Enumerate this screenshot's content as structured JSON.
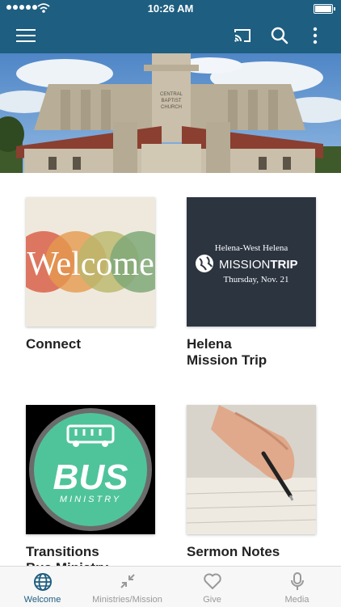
{
  "status_bar": {
    "time": "10:26 AM"
  },
  "colors": {
    "brand": "#1e5e80",
    "tab_inactive": "#999999",
    "bus_green": "#4fc49a"
  },
  "toolbar": {
    "icons": [
      "menu-icon",
      "cast-icon",
      "search-icon",
      "more-vertical-icon"
    ]
  },
  "hero": {
    "sign_text": "CENTRAL\nBAPTIST\nCHURCH"
  },
  "cards": [
    {
      "title": "Connect",
      "thumb_text": "Welcome"
    },
    {
      "title": "Helena\nMission Trip",
      "thumb_line1": "Helena-West Helena",
      "thumb_line2a": "MISSION",
      "thumb_line2b": "TRIP",
      "thumb_line3": "Thursday, Nov. 21"
    },
    {
      "title": "Transitions\nBus Ministry",
      "thumb_big": "BUS",
      "thumb_small": "MINISTRY"
    },
    {
      "title": "Sermon Notes"
    }
  ],
  "tabs": [
    {
      "label": "Welcome",
      "icon": "globe-icon",
      "active": true
    },
    {
      "label": "Ministries/Mission",
      "icon": "compress-icon",
      "active": false
    },
    {
      "label": "Give",
      "icon": "heart-icon",
      "active": false
    },
    {
      "label": "Media",
      "icon": "microphone-icon",
      "active": false
    }
  ]
}
